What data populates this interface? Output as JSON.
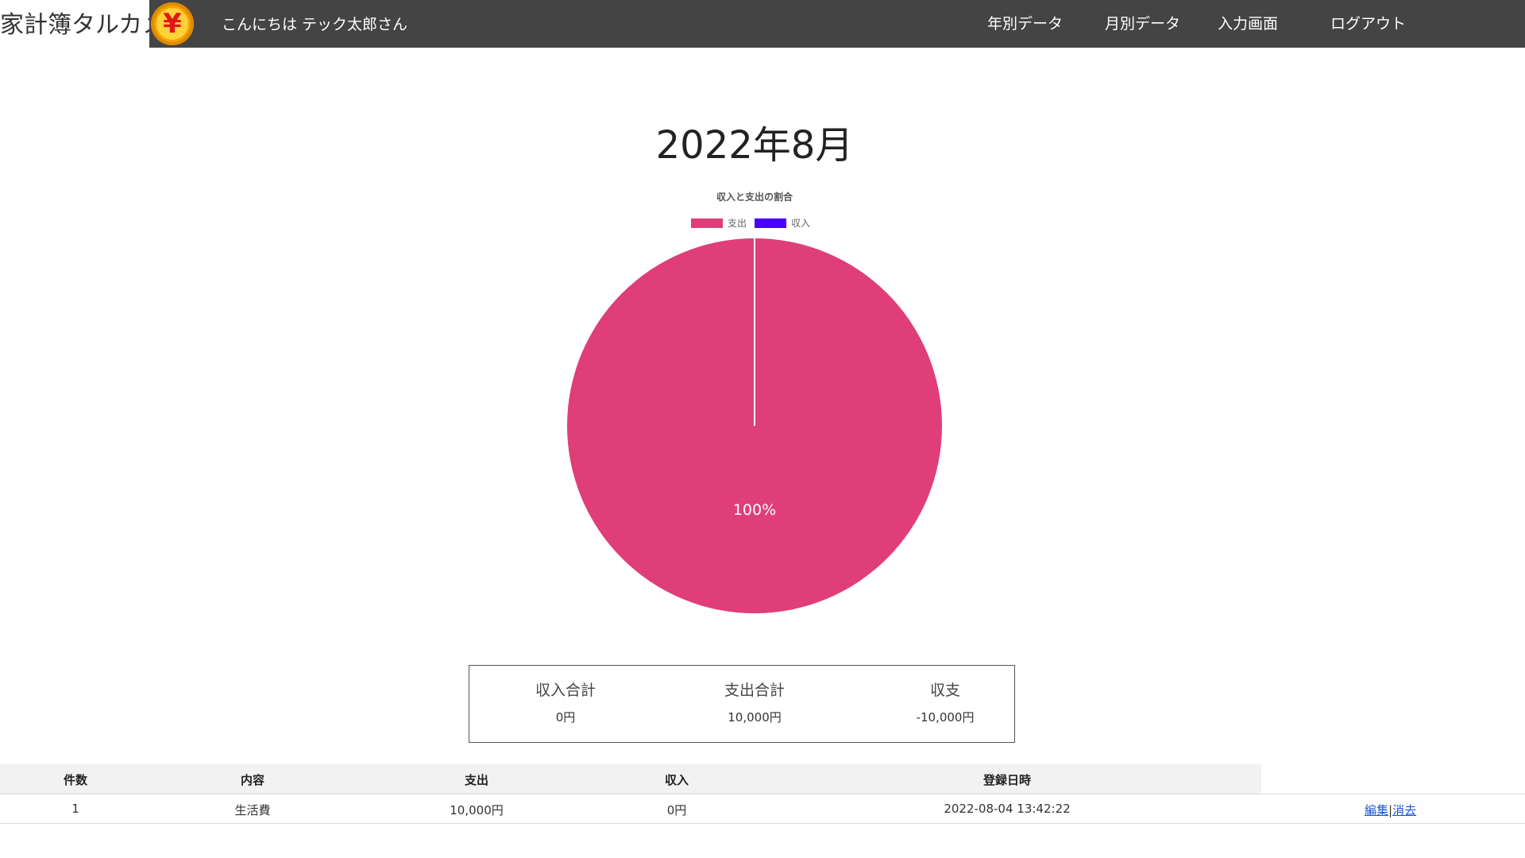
{
  "header": {
    "brand": "家計簿タルカメ",
    "logo_glyph": "¥",
    "greeting": "こんにちは テック太郎さん",
    "nav": [
      "年別データ",
      "月別データ",
      "入力画面",
      "ログアウト"
    ]
  },
  "page": {
    "title": "2022年8月"
  },
  "chart_data": {
    "type": "pie",
    "title": "収入と支出の割合",
    "legend": [
      {
        "name": "支出",
        "color": "#df3e79"
      },
      {
        "name": "収入",
        "color": "#4b00ff"
      }
    ],
    "slices": [
      {
        "name": "支出",
        "value": 100,
        "color": "#df3e79"
      },
      {
        "name": "収入",
        "value": 0,
        "color": "#4b00ff"
      }
    ],
    "data_labels": [
      "100%"
    ],
    "legend_position": "top"
  },
  "summary": {
    "income_label": "収入合計",
    "income_value": "0円",
    "expense_label": "支出合計",
    "expense_value": "10,000円",
    "balance_label": "収支",
    "balance_value": "-10,000円"
  },
  "table": {
    "headers": [
      "件数",
      "内容",
      "支出",
      "収入",
      "登録日時"
    ],
    "rows": [
      {
        "count": "1",
        "content": "生活費",
        "expense": "10,000円",
        "income": "0円",
        "registered": "2022-08-04 13:42:22"
      }
    ],
    "edit_label": "編集",
    "separator": "|",
    "delete_label": "消去"
  },
  "colors": {
    "topbar": "#444444",
    "expense": "#df3e79",
    "income": "#4b00ff"
  }
}
